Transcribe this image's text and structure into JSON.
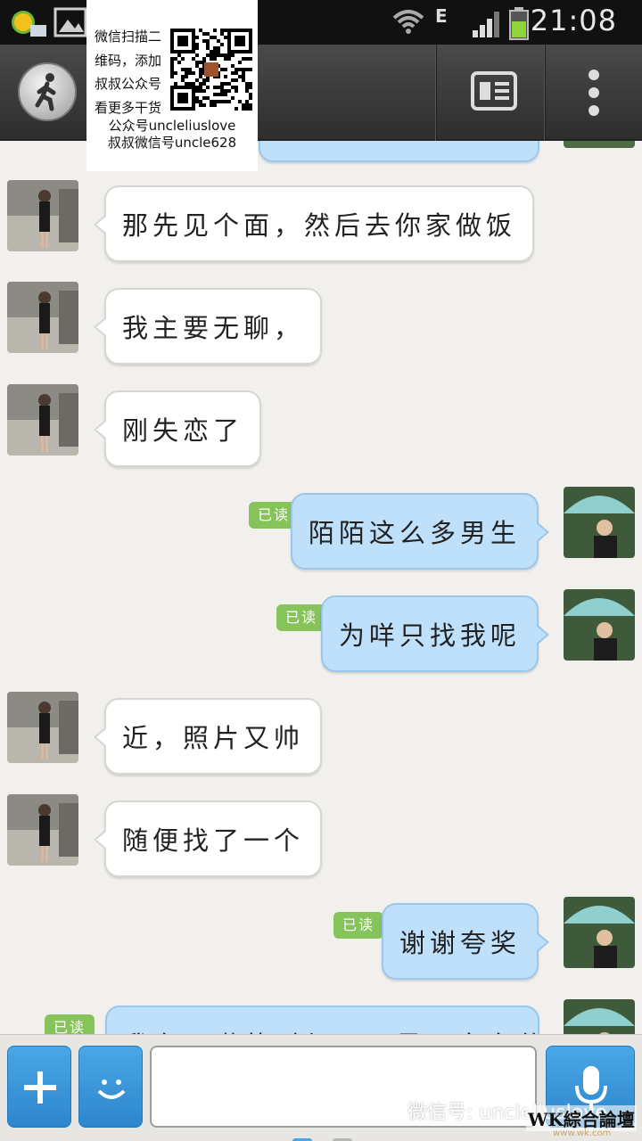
{
  "status_bar": {
    "time": "21:08",
    "network_type": "E"
  },
  "promo": {
    "lines": [
      "微信扫描二",
      "维码，添加",
      "叔叔公众号",
      "看更多干货"
    ],
    "footer": [
      "公众号uncleliuslove",
      "叔叔微信号uncle628"
    ]
  },
  "read_label": "已读",
  "messages": [
    {
      "side": "in",
      "text": "那先见个面，然后去你家做饭"
    },
    {
      "side": "in",
      "text": "我主要无聊，"
    },
    {
      "side": "in",
      "text": "刚失恋了"
    },
    {
      "side": "out",
      "text": "陌陌这么多男生",
      "read": "已读"
    },
    {
      "side": "out",
      "text": "为咩只找我呢",
      "read": "已读"
    },
    {
      "side": "in",
      "text": "近，照片又帅"
    },
    {
      "side": "in",
      "text": "随便找了一个"
    },
    {
      "side": "out",
      "text": "谢谢夸奖",
      "read": "已读"
    },
    {
      "side": "out",
      "text": "我在一啦的时候，又是一文东什么",
      "read": "已读"
    }
  ],
  "input": {
    "value": "",
    "placeholder": ""
  },
  "watermark": "微信号: uncleliuslove",
  "forum_mark": "WK綜合論壇",
  "forum_url": "www.wk.com",
  "colors": {
    "incoming_bubble": "#ffffff",
    "outgoing_bubble": "#bfe0fb",
    "read_badge": "#86c35a",
    "accent_button": "#2d86cc"
  },
  "icons": [
    "add-app-icon",
    "image-icon",
    "wifi-icon",
    "signal-icon",
    "battery-icon",
    "walking-person-icon",
    "profile-card-icon",
    "more-icon",
    "plus-icon",
    "emoji-icon",
    "microphone-icon",
    "wechat-logo-icon"
  ]
}
